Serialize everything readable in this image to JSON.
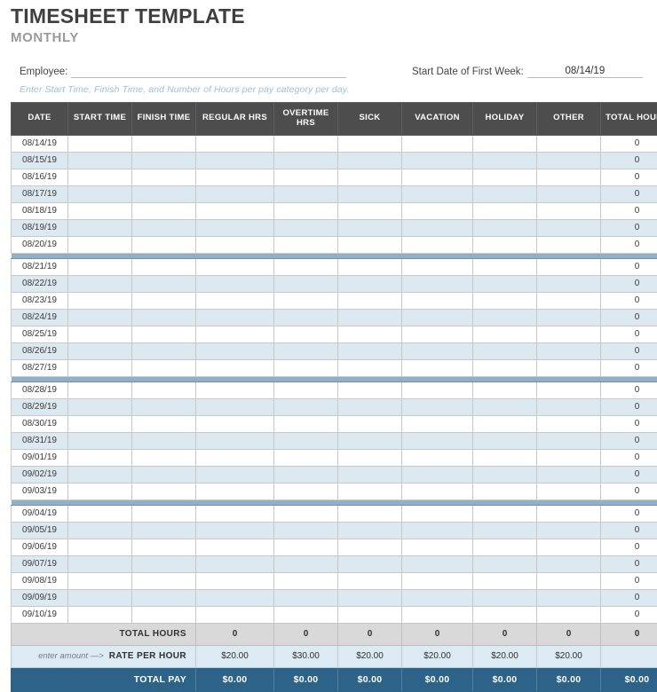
{
  "header": {
    "title": "TIMESHEET TEMPLATE",
    "subtitle": "MONTHLY",
    "employee_label": "Employee:",
    "employee_value": "",
    "start_date_label": "Start Date of First Week:",
    "start_date_value": "08/14/19",
    "instruction": "Enter Start Time, Finish Time, and Number of Hours per pay category per day."
  },
  "table": {
    "columns": [
      "DATE",
      "START TIME",
      "FINISH TIME",
      "REGULAR HRS",
      "OVERTIME HRS",
      "SICK",
      "VACATION",
      "HOLIDAY",
      "OTHER",
      "TOTAL HOURS"
    ],
    "weeks": [
      {
        "rows": [
          {
            "date": "08/14/19",
            "start": "",
            "finish": "",
            "regular": "",
            "overtime": "",
            "sick": "",
            "vacation": "",
            "holiday": "",
            "other": "",
            "total": "0"
          },
          {
            "date": "08/15/19",
            "start": "",
            "finish": "",
            "regular": "",
            "overtime": "",
            "sick": "",
            "vacation": "",
            "holiday": "",
            "other": "",
            "total": "0"
          },
          {
            "date": "08/16/19",
            "start": "",
            "finish": "",
            "regular": "",
            "overtime": "",
            "sick": "",
            "vacation": "",
            "holiday": "",
            "other": "",
            "total": "0"
          },
          {
            "date": "08/17/19",
            "start": "",
            "finish": "",
            "regular": "",
            "overtime": "",
            "sick": "",
            "vacation": "",
            "holiday": "",
            "other": "",
            "total": "0"
          },
          {
            "date": "08/18/19",
            "start": "",
            "finish": "",
            "regular": "",
            "overtime": "",
            "sick": "",
            "vacation": "",
            "holiday": "",
            "other": "",
            "total": "0"
          },
          {
            "date": "08/19/19",
            "start": "",
            "finish": "",
            "regular": "",
            "overtime": "",
            "sick": "",
            "vacation": "",
            "holiday": "",
            "other": "",
            "total": "0"
          },
          {
            "date": "08/20/19",
            "start": "",
            "finish": "",
            "regular": "",
            "overtime": "",
            "sick": "",
            "vacation": "",
            "holiday": "",
            "other": "",
            "total": "0"
          }
        ]
      },
      {
        "rows": [
          {
            "date": "08/21/19",
            "start": "",
            "finish": "",
            "regular": "",
            "overtime": "",
            "sick": "",
            "vacation": "",
            "holiday": "",
            "other": "",
            "total": "0"
          },
          {
            "date": "08/22/19",
            "start": "",
            "finish": "",
            "regular": "",
            "overtime": "",
            "sick": "",
            "vacation": "",
            "holiday": "",
            "other": "",
            "total": "0"
          },
          {
            "date": "08/23/19",
            "start": "",
            "finish": "",
            "regular": "",
            "overtime": "",
            "sick": "",
            "vacation": "",
            "holiday": "",
            "other": "",
            "total": "0"
          },
          {
            "date": "08/24/19",
            "start": "",
            "finish": "",
            "regular": "",
            "overtime": "",
            "sick": "",
            "vacation": "",
            "holiday": "",
            "other": "",
            "total": "0"
          },
          {
            "date": "08/25/19",
            "start": "",
            "finish": "",
            "regular": "",
            "overtime": "",
            "sick": "",
            "vacation": "",
            "holiday": "",
            "other": "",
            "total": "0"
          },
          {
            "date": "08/26/19",
            "start": "",
            "finish": "",
            "regular": "",
            "overtime": "",
            "sick": "",
            "vacation": "",
            "holiday": "",
            "other": "",
            "total": "0"
          },
          {
            "date": "08/27/19",
            "start": "",
            "finish": "",
            "regular": "",
            "overtime": "",
            "sick": "",
            "vacation": "",
            "holiday": "",
            "other": "",
            "total": "0"
          }
        ]
      },
      {
        "rows": [
          {
            "date": "08/28/19",
            "start": "",
            "finish": "",
            "regular": "",
            "overtime": "",
            "sick": "",
            "vacation": "",
            "holiday": "",
            "other": "",
            "total": "0"
          },
          {
            "date": "08/29/19",
            "start": "",
            "finish": "",
            "regular": "",
            "overtime": "",
            "sick": "",
            "vacation": "",
            "holiday": "",
            "other": "",
            "total": "0"
          },
          {
            "date": "08/30/19",
            "start": "",
            "finish": "",
            "regular": "",
            "overtime": "",
            "sick": "",
            "vacation": "",
            "holiday": "",
            "other": "",
            "total": "0"
          },
          {
            "date": "08/31/19",
            "start": "",
            "finish": "",
            "regular": "",
            "overtime": "",
            "sick": "",
            "vacation": "",
            "holiday": "",
            "other": "",
            "total": "0"
          },
          {
            "date": "09/01/19",
            "start": "",
            "finish": "",
            "regular": "",
            "overtime": "",
            "sick": "",
            "vacation": "",
            "holiday": "",
            "other": "",
            "total": "0"
          },
          {
            "date": "09/02/19",
            "start": "",
            "finish": "",
            "regular": "",
            "overtime": "",
            "sick": "",
            "vacation": "",
            "holiday": "",
            "other": "",
            "total": "0"
          },
          {
            "date": "09/03/19",
            "start": "",
            "finish": "",
            "regular": "",
            "overtime": "",
            "sick": "",
            "vacation": "",
            "holiday": "",
            "other": "",
            "total": "0"
          }
        ]
      },
      {
        "rows": [
          {
            "date": "09/04/19",
            "start": "",
            "finish": "",
            "regular": "",
            "overtime": "",
            "sick": "",
            "vacation": "",
            "holiday": "",
            "other": "",
            "total": "0"
          },
          {
            "date": "09/05/19",
            "start": "",
            "finish": "",
            "regular": "",
            "overtime": "",
            "sick": "",
            "vacation": "",
            "holiday": "",
            "other": "",
            "total": "0"
          },
          {
            "date": "09/06/19",
            "start": "",
            "finish": "",
            "regular": "",
            "overtime": "",
            "sick": "",
            "vacation": "",
            "holiday": "",
            "other": "",
            "total": "0"
          },
          {
            "date": "09/07/19",
            "start": "",
            "finish": "",
            "regular": "",
            "overtime": "",
            "sick": "",
            "vacation": "",
            "holiday": "",
            "other": "",
            "total": "0"
          },
          {
            "date": "09/08/19",
            "start": "",
            "finish": "",
            "regular": "",
            "overtime": "",
            "sick": "",
            "vacation": "",
            "holiday": "",
            "other": "",
            "total": "0"
          },
          {
            "date": "09/09/19",
            "start": "",
            "finish": "",
            "regular": "",
            "overtime": "",
            "sick": "",
            "vacation": "",
            "holiday": "",
            "other": "",
            "total": "0"
          },
          {
            "date": "09/10/19",
            "start": "",
            "finish": "",
            "regular": "",
            "overtime": "",
            "sick": "",
            "vacation": "",
            "holiday": "",
            "other": "",
            "total": "0"
          }
        ]
      }
    ],
    "footer": {
      "total_hours": {
        "label": "TOTAL HOURS",
        "values": [
          "0",
          "0",
          "0",
          "0",
          "0",
          "0",
          "0"
        ]
      },
      "rate_per_hour": {
        "hint": "enter amount —>",
        "label": "RATE PER HOUR",
        "values": [
          "$20.00",
          "$30.00",
          "$20.00",
          "$20.00",
          "$20.00",
          "$20.00"
        ],
        "total_cell": ""
      },
      "total_pay": {
        "label": "TOTAL PAY",
        "values": [
          "$0.00",
          "$0.00",
          "$0.00",
          "$0.00",
          "$0.00",
          "$0.00",
          "$0.00"
        ]
      }
    }
  },
  "colors": {
    "header_bg": "#4d4d4d",
    "alt_row_bg": "#dce9f1",
    "week_separator": "#8fb0c6",
    "totals_bg": "#d9d9d9",
    "rate_bg": "#dceaf4",
    "pay_bg": "#2e6389",
    "instruction_text": "#9dc0dc",
    "subtitle_text": "#9a9a9a"
  }
}
